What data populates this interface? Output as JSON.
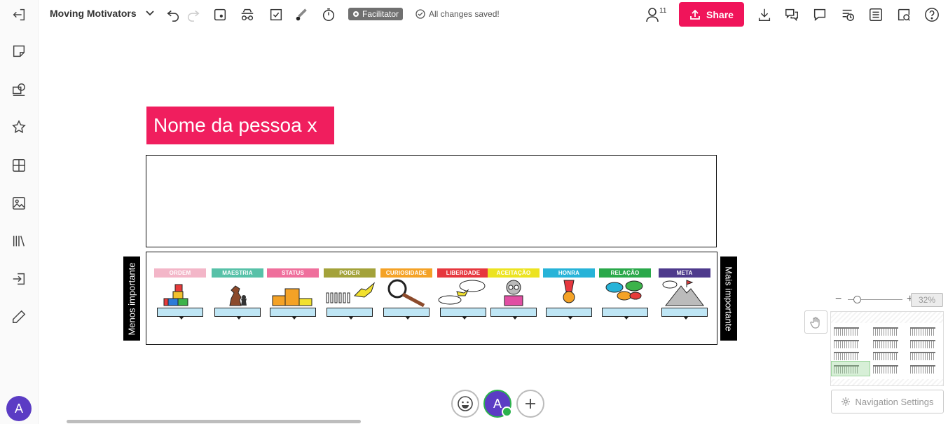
{
  "topbar": {
    "board_title": "Moving Motivators",
    "facilitator_label": "Facilitator",
    "saved_status": "All changes saved!",
    "user_count": "11",
    "share_label": "Share"
  },
  "canvas": {
    "name_card": "Nome da pessoa x",
    "left_label": "Menos importante",
    "right_label": "Mais importante",
    "cards": [
      {
        "title": "ORDEM",
        "color": "#f3b6c8"
      },
      {
        "title": "MAESTRIA",
        "color": "#57c1a8"
      },
      {
        "title": "STATUS",
        "color": "#ef6f9c"
      },
      {
        "title": "PODER",
        "color": "#a3a23a"
      },
      {
        "title": "CURIOSIDADE",
        "color": "#f4a226"
      },
      {
        "title": "LIBERDADE",
        "color": "#e6373e"
      },
      {
        "title": "ACEITAÇÃO",
        "color": "#ece321"
      },
      {
        "title": "HONRA",
        "color": "#27b3d8"
      },
      {
        "title": "RELAÇÃO",
        "color": "#2aa84a"
      },
      {
        "title": "META",
        "color": "#4e3a8c"
      }
    ]
  },
  "bottom": {
    "avatar_initial": "A"
  },
  "sidebar": {
    "avatar_initial": "A"
  },
  "navigator": {
    "zoom_value": "32%",
    "settings_label": "Navigation Settings"
  }
}
